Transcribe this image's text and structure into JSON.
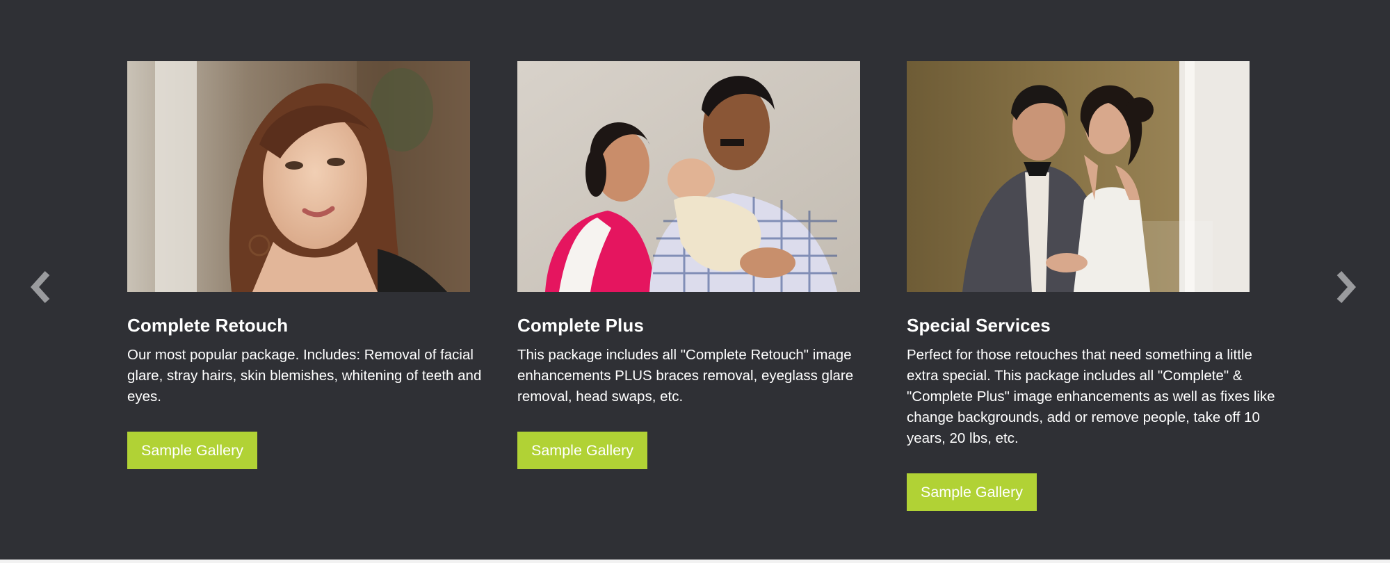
{
  "carousel": {
    "prev_icon": "chevron-left-icon",
    "next_icon": "chevron-right-icon",
    "arrow_color": "#9a9b9e",
    "background_color": "#2f3035",
    "accent_color": "#b1d235",
    "cards": [
      {
        "title": "Complete Retouch",
        "description": "Our most popular package. Includes: Removal of facial glare, stray hairs, skin blemishes, whitening of teeth and eyes.",
        "button_label": "Sample Gallery",
        "image": "portrait-woman-photo"
      },
      {
        "title": "Complete Plus",
        "description": "This package includes all \"Complete Retouch\" image enhancements PLUS braces removal, eyeglass glare removal, head swaps, etc.",
        "button_label": "Sample Gallery",
        "image": "family-with-newborn-photo"
      },
      {
        "title": "Special Services",
        "description": "Perfect for those retouches that need something a little extra special. This package includes all \"Complete\" & \"Complete Plus\" image enhancements as well as fixes like change backgrounds, add or remove people, take off 10 years, 20 lbs, etc.",
        "button_label": "Sample Gallery",
        "image": "wedding-couple-photo"
      }
    ]
  }
}
